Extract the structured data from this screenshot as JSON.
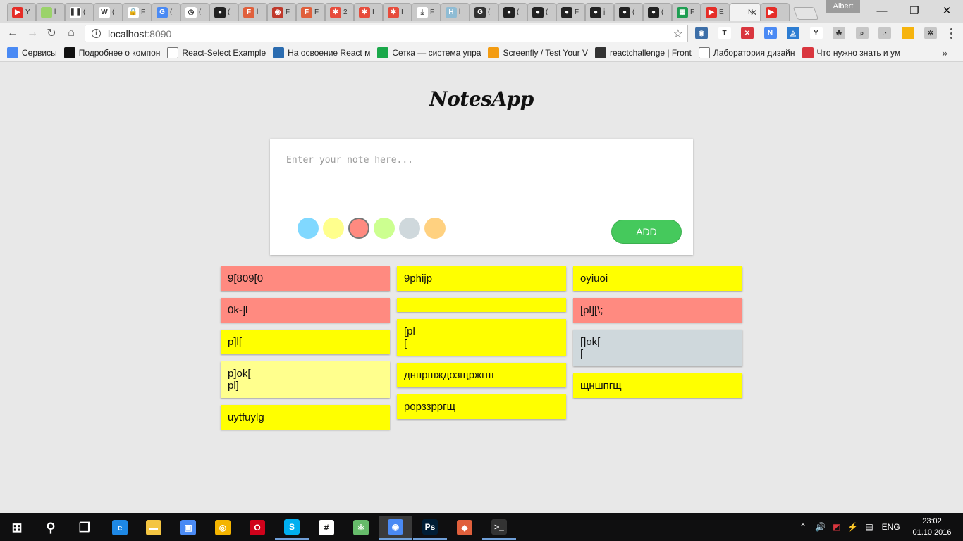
{
  "browser": {
    "tabs": [
      {
        "icon": "youtube-icon",
        "color": "#e52d27",
        "glyph": "▶",
        "label": "Y"
      },
      {
        "icon": "drive-icon",
        "color": "#9bd36a",
        "glyph": "",
        "label": "l"
      },
      {
        "icon": "pause-icon",
        "color": "#ffffff",
        "glyph": "❚❚",
        "label": "("
      },
      {
        "icon": "wikipedia-icon",
        "color": "#ffffff",
        "glyph": "W",
        "label": "("
      },
      {
        "icon": "lock-icon",
        "color": "#ffffff",
        "glyph": "🔒",
        "label": "F"
      },
      {
        "icon": "translate-icon",
        "color": "#4a8af4",
        "glyph": "G",
        "label": "("
      },
      {
        "icon": "clock-icon",
        "color": "#ffffff",
        "glyph": "◷",
        "label": "("
      },
      {
        "icon": "github-icon",
        "color": "#222222",
        "glyph": "●",
        "label": "("
      },
      {
        "icon": "f-icon",
        "color": "#e0603c",
        "glyph": "F",
        "label": "l"
      },
      {
        "icon": "opera-icon",
        "color": "#c0392b",
        "glyph": "◉",
        "label": "F"
      },
      {
        "icon": "f-icon",
        "color": "#e0603c",
        "glyph": "F",
        "label": "F"
      },
      {
        "icon": "figure-icon",
        "color": "#e74c3c",
        "glyph": "✱",
        "label": "2"
      },
      {
        "icon": "figure-icon",
        "color": "#e74c3c",
        "glyph": "✱",
        "label": "I"
      },
      {
        "icon": "figure-icon",
        "color": "#e74c3c",
        "glyph": "✱",
        "label": "I"
      },
      {
        "icon": "download-icon",
        "color": "#ffffff",
        "glyph": "⤓",
        "label": "F"
      },
      {
        "icon": "h-icon",
        "color": "#8fbcd4",
        "glyph": "H",
        "label": "l"
      },
      {
        "icon": "g-icon",
        "color": "#333333",
        "glyph": "G",
        "label": "("
      },
      {
        "icon": "github-icon",
        "color": "#222222",
        "glyph": "●",
        "label": "("
      },
      {
        "icon": "github-icon",
        "color": "#222222",
        "glyph": "●",
        "label": "("
      },
      {
        "icon": "github-icon",
        "color": "#222222",
        "glyph": "●",
        "label": "F"
      },
      {
        "icon": "github-icon",
        "color": "#222222",
        "glyph": "●",
        "label": "j"
      },
      {
        "icon": "github-icon",
        "color": "#222222",
        "glyph": "●",
        "label": "("
      },
      {
        "icon": "github-icon",
        "color": "#222222",
        "glyph": "●",
        "label": "("
      },
      {
        "icon": "sheets-icon",
        "color": "#1e9e52",
        "glyph": "▦",
        "label": "F"
      },
      {
        "icon": "youtube-icon",
        "color": "#e52d27",
        "glyph": "▶",
        "label": "E"
      },
      {
        "icon": "notesapp-tab-icon",
        "color": "#f2f2f2",
        "glyph": "",
        "label": "N",
        "active": true
      },
      {
        "icon": "youtube-icon",
        "color": "#e52d27",
        "glyph": "▶",
        "label": ""
      }
    ],
    "profile_name": "Albert",
    "url_host": "localhost",
    "url_port": ":8090",
    "bookmarks": [
      {
        "icon": "apps-grid-icon",
        "color": "#4a8af4",
        "label": "Сервисы"
      },
      {
        "icon": "it-icon",
        "color": "#111111",
        "label": "Подробнее о компон"
      },
      {
        "icon": "page-icon",
        "color": "#ffffff",
        "label": "React-Select Example"
      },
      {
        "icon": "css-live-icon",
        "color": "#2b6cb0",
        "label": "На освоение React м"
      },
      {
        "icon": "setka-icon",
        "color": "#1aa84a",
        "label": "Сетка — система упра"
      },
      {
        "icon": "screenfly-icon",
        "color": "#f39c12",
        "label": "Screenfly / Test Your V"
      },
      {
        "icon": "hash-icon",
        "color": "#333333",
        "label": "reactchallenge | Front"
      },
      {
        "icon": "lab-icon",
        "color": "#ffffff",
        "label": "Лаборатория дизайн"
      },
      {
        "icon": "vivaldi-icon",
        "color": "#d9363e",
        "label": "Что нужно знать и ум"
      }
    ],
    "extensions": [
      {
        "icon": "globe-icon",
        "color": "#3d6fa8",
        "glyph": "◉"
      },
      {
        "icon": "t-icon",
        "color": "#ffffff",
        "glyph": "T"
      },
      {
        "icon": "adblock-icon",
        "color": "#d9363e",
        "glyph": "✕"
      },
      {
        "icon": "new-ext-icon",
        "color": "#4a8af4",
        "glyph": "N"
      },
      {
        "icon": "vpn-icon",
        "color": "#2d7dd2",
        "glyph": "◬"
      },
      {
        "icon": "y-icon",
        "color": "#ffffff",
        "glyph": "Y"
      },
      {
        "icon": "leaf-icon",
        "color": "#c7c7c7",
        "glyph": "☘"
      },
      {
        "icon": "zoom-icon",
        "color": "#c7c7c7",
        "glyph": "⌕"
      },
      {
        "icon": "speed-icon",
        "color": "#c7c7c7",
        "glyph": "◔"
      },
      {
        "icon": "flag-icon",
        "color": "#f6b40e",
        "glyph": ""
      },
      {
        "icon": "gear-ext-icon",
        "color": "#c7c7c7",
        "glyph": "✲"
      }
    ]
  },
  "app": {
    "title": "NotesApp",
    "editor_placeholder": "Enter your note here...",
    "add_label": "ADD",
    "swatches": [
      {
        "color": "#80d8ff",
        "selected": false
      },
      {
        "color": "#ffff8d",
        "selected": false
      },
      {
        "color": "#ff8a80",
        "selected": true
      },
      {
        "color": "#ccff90",
        "selected": false
      },
      {
        "color": "#cfd8dc",
        "selected": false
      },
      {
        "color": "#ffd180",
        "selected": false
      }
    ],
    "columns": [
      [
        {
          "text": "9[809[0",
          "color": "#ff8a80"
        },
        {
          "text": "0k-]l",
          "color": "#ff8a80"
        },
        {
          "text": "p]l[",
          "color": "#ffff00"
        },
        {
          "text": "p]ok[\npl]",
          "color": "#ffff8d"
        },
        {
          "text": "uytfuylg",
          "color": "#ffff00"
        }
      ],
      [
        {
          "text": "9phijp",
          "color": "#ffff00"
        },
        {
          "text": "",
          "color": "#ffff00"
        },
        {
          "text": "[pl\n[",
          "color": "#ffff00"
        },
        {
          "text": "днпршждозщржгш",
          "color": "#ffff00"
        },
        {
          "text": "рорззрргщ",
          "color": "#ffff00"
        }
      ],
      [
        {
          "text": "oyiuoi",
          "color": "#ffff00"
        },
        {
          "text": "[pl][\\;",
          "color": "#ff8a80"
        },
        {
          "text": "[]ok[\n[",
          "color": "#cfd8dc"
        },
        {
          "text": "щншпгщ",
          "color": "#ffff00"
        }
      ]
    ]
  },
  "taskbar": {
    "apps": [
      {
        "icon": "windows-start-icon",
        "color": "#ffffff",
        "glyph": "⊞",
        "running": false
      },
      {
        "icon": "search-icon",
        "color": "#ffffff",
        "glyph": "⚲",
        "running": false
      },
      {
        "icon": "task-view-icon",
        "color": "#ffffff",
        "glyph": "❐",
        "running": false
      },
      {
        "icon": "edge-icon",
        "color": "#1e88e5",
        "glyph": "e",
        "running": false
      },
      {
        "icon": "file-explorer-icon",
        "color": "#f4c542",
        "glyph": "▬",
        "running": false
      },
      {
        "icon": "store-icon",
        "color": "#4a8af4",
        "glyph": "▣",
        "running": false
      },
      {
        "icon": "chrome-canary-icon",
        "color": "#f4b400",
        "glyph": "◎",
        "running": false
      },
      {
        "icon": "opera-icon",
        "color": "#d0021b",
        "glyph": "O",
        "running": false
      },
      {
        "icon": "skype-icon",
        "color": "#00aff0",
        "glyph": "S",
        "running": true
      },
      {
        "icon": "slack-icon",
        "color": "#ffffff",
        "glyph": "#",
        "running": false
      },
      {
        "icon": "atom-icon",
        "color": "#66bb6a",
        "glyph": "⚛",
        "running": false
      },
      {
        "icon": "chrome-icon",
        "color": "#4a8af4",
        "glyph": "◉",
        "running": true,
        "active": true
      },
      {
        "icon": "photoshop-icon",
        "color": "#001d34",
        "glyph": "Ps",
        "running": true
      },
      {
        "icon": "git-kraken-icon",
        "color": "#e0603c",
        "glyph": "◆",
        "running": false
      },
      {
        "icon": "terminal-icon",
        "color": "#333333",
        "glyph": ">_",
        "running": true
      }
    ],
    "language": "ENG",
    "time": "23:02",
    "date": "01.10.2016"
  }
}
